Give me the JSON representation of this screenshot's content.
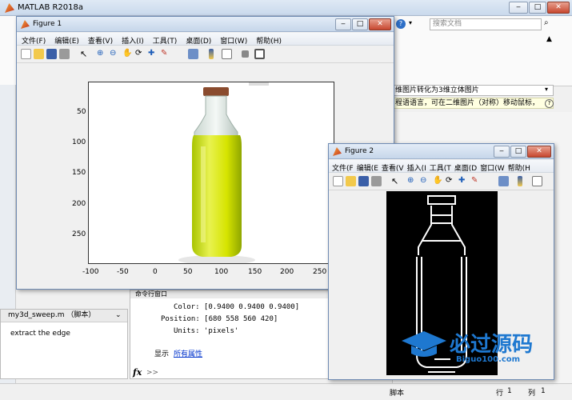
{
  "main": {
    "title": "MATLAB R2018a",
    "search_placeholder": "搜索文档",
    "address": "维图片转化为3维立体图片",
    "info": "程语语言，可在二维图片（对称）移动鼠标，",
    "detail_title": "my3d_sweep.m （脚本）",
    "detail_text": "extract the edge",
    "cmd_title": "命令行窗口",
    "cmd_lines": [
      "Color: [0.9400 0.9400 0.9400]",
      "Position: [680 558 560 420]",
      "Units: 'pixels'"
    ],
    "show_label": "显示",
    "all_props_link": "所有属性",
    "prompt": ">>",
    "status": {
      "script": "脚本",
      "row_label": "行",
      "row": "1",
      "col_label": "列",
      "col": "1"
    }
  },
  "figure1": {
    "title": "Figure 1",
    "menus": [
      "文件(F)",
      "编辑(E)",
      "查看(V)",
      "插入(I)",
      "工具(T)",
      "桌面(D)",
      "窗口(W)",
      "帮助(H)"
    ],
    "yticks": [
      "50",
      "100",
      "150",
      "200",
      "250"
    ],
    "xticks": [
      "-100",
      "-50",
      "0",
      "50",
      "100",
      "150",
      "200",
      "250"
    ]
  },
  "figure2": {
    "title": "Figure 2",
    "menus": [
      "文件(F",
      "编辑(E",
      "查看(V",
      "插入(I",
      "工具(T",
      "桌面(D",
      "窗口(W",
      "帮助(H"
    ]
  },
  "watermark": {
    "brand": "必过源码",
    "site": "Biguo100.com"
  }
}
